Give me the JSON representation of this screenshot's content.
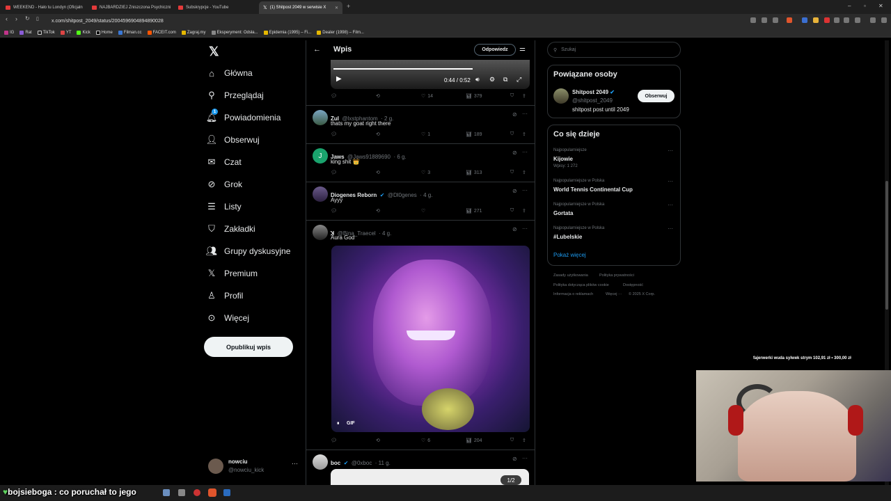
{
  "browser": {
    "tabs": [
      {
        "title": "WEEKEND - Hało tu Londyn (Oficjaln"
      },
      {
        "title": "NAJBARDZIEJ Zniszczona Psychiczni"
      },
      {
        "title": "Subskrypcje - YouTube"
      },
      {
        "title": "(1) Shitpost 2049 w serwisie X"
      }
    ],
    "url": "x.com/shitpost_2049/status/2004596904894890028",
    "bookmarks": [
      "IG",
      "Rat",
      "TikTok",
      "YT",
      "Kick",
      "Home",
      "Filman.cc",
      "FACEIT.com",
      "Zagraj.my",
      "Eksperyment: Odsła...",
      "Epidemia (1995) – Fi...",
      "Dealer (1998) – Film..."
    ]
  },
  "nav": {
    "items": [
      {
        "label": "Główna",
        "icon": "home-icon"
      },
      {
        "label": "Przeglądaj",
        "icon": "search-icon"
      },
      {
        "label": "Powiadomienia",
        "icon": "bell-icon"
      },
      {
        "label": "Obserwuj",
        "icon": "follow-icon"
      },
      {
        "label": "Czat",
        "icon": "mail-icon"
      },
      {
        "label": "Grok",
        "icon": "grok-icon"
      },
      {
        "label": "Listy",
        "icon": "list-icon"
      },
      {
        "label": "Zakładki",
        "icon": "bookmark-icon"
      },
      {
        "label": "Grupy dyskusyjne",
        "icon": "groups-icon"
      },
      {
        "label": "Premium",
        "icon": "x-icon"
      },
      {
        "label": "Profil",
        "icon": "profile-icon"
      },
      {
        "label": "Więcej",
        "icon": "more-icon"
      }
    ],
    "notification_badge": "1",
    "post_button": "Opublikuj wpis",
    "account": {
      "name": "nowciu",
      "handle": "@nowciu_kick"
    }
  },
  "header": {
    "title": "Wpis",
    "reply_button": "Odpowiedz"
  },
  "video": {
    "time": "0:44 / 0:52"
  },
  "main_post_stats": {
    "likes": "14",
    "views": "379"
  },
  "replies": [
    {
      "name": "Zul",
      "handle": "@lxstphantom",
      "time": "· 2 g.",
      "text": "thats my goat right there",
      "likes": "1",
      "views": "189"
    },
    {
      "name": "Jaws",
      "handle": "@Jaws91889690",
      "time": "· 6 g.",
      "text": "king shit 👑",
      "likes": "3",
      "views": "313"
    },
    {
      "name": "Diogenes Reborn",
      "handle": "@Dl0genes",
      "time": "· 4 g.",
      "text": "Ayyy",
      "likes": "",
      "views": "271"
    },
    {
      "name": "ꓘ",
      "handle": "@Bina_Traecel",
      "time": "· 4 g.",
      "text": "Aura God",
      "likes": "6",
      "views": "204",
      "media_badge": "GIF"
    },
    {
      "name": "boc",
      "handle": "@0xboc",
      "time": "· 11 g.",
      "text": "",
      "media_counter": "1/2"
    }
  ],
  "right": {
    "search_placeholder": "Szukaj",
    "related_title": "Powiązane osoby",
    "related": {
      "name": "Shitpost 2049",
      "handle": "@shitpost_2049",
      "bio": "shitpost post until 2049",
      "follow": "Obserwuj"
    },
    "trending_title": "Co się dzieje",
    "trends": [
      {
        "context": "Najpopularniejsze",
        "name": "Kijowie",
        "posts": "Wpisy: 1 272"
      },
      {
        "context": "Najpopularniejsze w Polska",
        "name": "World Tennis Continental Cup",
        "posts": ""
      },
      {
        "context": "Najpopularniejsze w Polska",
        "name": "Gortata",
        "posts": ""
      },
      {
        "context": "Najpopularniejsze w Polska",
        "name": "#Lubelskie",
        "posts": ""
      }
    ],
    "show_more": "Pokaż więcej",
    "footer": [
      "Zasady użytkowania",
      "Polityka prywatności",
      "Polityka dotycząca plików cookie",
      "Dostępność",
      "Informacja o reklamach",
      "Więcej ···",
      "© 2025 X Corp."
    ]
  },
  "stream": {
    "donation": "fajerwerki wuda sylwek strym  102,91 zł  •  300,00 zł",
    "chat": "bojsieboga : co poruchał to jego"
  }
}
